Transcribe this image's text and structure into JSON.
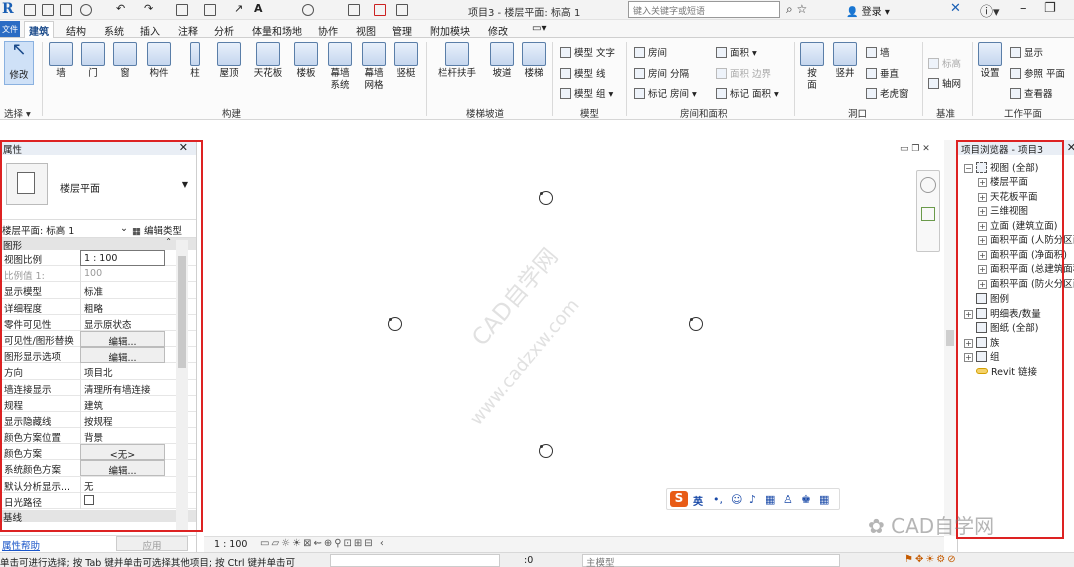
{
  "app": {
    "title": "项目3 - 楼层平面: 标高 1",
    "search_placeholder": "键入关键字或短语",
    "login": "登录",
    "logo": "R"
  },
  "tabs": [
    "文件",
    "建筑",
    "结构",
    "系统",
    "插入",
    "注释",
    "分析",
    "体量和场地",
    "协作",
    "视图",
    "管理",
    "附加模块",
    "修改"
  ],
  "active_tab": "建筑",
  "ribbon": {
    "select": {
      "modify_label": "修改",
      "panel_label": "选择 ▾"
    },
    "build": {
      "buttons": [
        "墙",
        "门",
        "窗",
        "构件",
        "柱",
        "屋顶",
        "天花板",
        "楼板",
        "幕墙\n系统",
        "幕墙\n网格",
        "竖梃"
      ],
      "panel_label": "构建"
    },
    "circulation": {
      "buttons": [
        "栏杆扶手",
        "坡道",
        "楼梯"
      ],
      "panel_label": "楼梯坡道"
    },
    "model": {
      "items": [
        "模型 文字",
        "模型 线",
        "模型 组"
      ],
      "panel_label": "模型"
    },
    "room_area": {
      "items_left": [
        "房间",
        "房间 分隔",
        "标记 房间"
      ],
      "items_right": [
        "面积",
        "面积 边界",
        "标记 面积"
      ],
      "panel_label": "房间和面积"
    },
    "opening": {
      "buttons": [
        "按\n面",
        "竖井"
      ],
      "items": [
        "墙",
        "垂直",
        "老虎窗"
      ],
      "panel_label": "洞口"
    },
    "datum": {
      "items": [
        "标高",
        "轴网"
      ],
      "panel_label": "基准"
    },
    "work_plane": {
      "button": "设置",
      "items": [
        "显示",
        "参照 平面",
        "查看器"
      ],
      "panel_label": "工作平面"
    }
  },
  "properties": {
    "title": "属性",
    "type_name": "楼层平面",
    "instance_selector": "楼层平面: 标高 1",
    "edit_type": "编辑类型",
    "group_graphics": "图形",
    "rows": [
      {
        "k": "视图比例",
        "v": "1 : 100",
        "style": "boxed"
      },
      {
        "k": "比例值 1:",
        "v": "100",
        "style": "dim"
      },
      {
        "k": "显示模型",
        "v": "标准",
        "style": ""
      },
      {
        "k": "详细程度",
        "v": "粗略",
        "style": ""
      },
      {
        "k": "零件可见性",
        "v": "显示原状态",
        "style": ""
      },
      {
        "k": "可见性/图形替换",
        "v": "编辑...",
        "style": "btn"
      },
      {
        "k": "图形显示选项",
        "v": "编辑...",
        "style": "btn"
      },
      {
        "k": "方向",
        "v": "项目北",
        "style": ""
      },
      {
        "k": "墙连接显示",
        "v": "清理所有墙连接",
        "style": ""
      },
      {
        "k": "规程",
        "v": "建筑",
        "style": ""
      },
      {
        "k": "显示隐藏线",
        "v": "按规程",
        "style": ""
      },
      {
        "k": "颜色方案位置",
        "v": "背景",
        "style": ""
      },
      {
        "k": "颜色方案",
        "v": "<无>",
        "style": "btn"
      },
      {
        "k": "系统颜色方案",
        "v": "编辑...",
        "style": "btn"
      },
      {
        "k": "默认分析显示...",
        "v": "无",
        "style": ""
      },
      {
        "k": "日光路径",
        "v": "",
        "style": "checkbox"
      }
    ],
    "group_underlay": "基线",
    "help_link": "属性帮助",
    "apply_button": "应用"
  },
  "canvas": {
    "watermark_cn": "CAD自学网",
    "watermark_url": "www.cadzxw.com",
    "ime_label": "英"
  },
  "browser": {
    "title": "项目浏览器 - 项目3",
    "views_label": "视图 (全部)",
    "views": [
      "楼层平面",
      "天花板平面",
      "三维视图",
      "立面 (建筑立面)",
      "面积平面 (人防分区面积)",
      "面积平面 (净面积)",
      "面积平面 (总建筑面积)",
      "面积平面 (防火分区面积)"
    ],
    "others": [
      "图例",
      "明细表/数量",
      "图纸 (全部)",
      "族",
      "组",
      "Revit 链接"
    ]
  },
  "view_control": {
    "scale": "1 : 100"
  },
  "status": {
    "message": "单击可进行选择; 按 Tab 键并单击可选择其他项目; 按 Ctrl 键并单击可",
    "count": ":0",
    "model_dropdown": "主模型"
  },
  "brand_watermark": "CAD自学网",
  "colors": {
    "accent": "#2b6cc4",
    "highlight_red": "#dd2222"
  }
}
